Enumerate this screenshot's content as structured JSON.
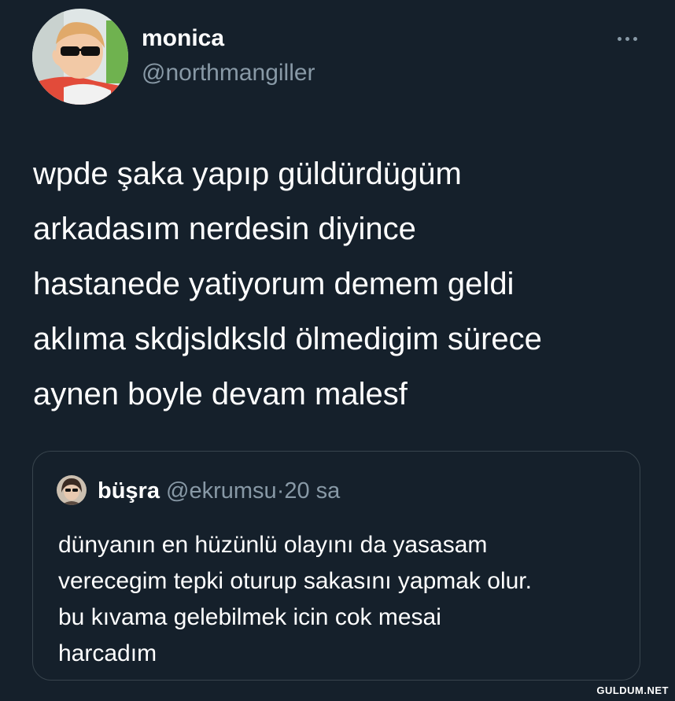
{
  "tweet": {
    "author": {
      "display_name": "monica",
      "handle": "@northmangiller",
      "avatar_icon": "profile-photo-child-sunglasses-icon"
    },
    "more_icon": "more-options-icon",
    "text": "wpde şaka yapıp güldürdügüm\narkadasım nerdesin diyince\nhastanede yatiyorum demem geldi\naklıma skdjsldksld ölmedigim sürece\naynen boyle devam malesf"
  },
  "quoted_tweet": {
    "display_name": "büşra",
    "handle": "@ekrumsu",
    "separator": "·",
    "time": "20 sa",
    "avatar_icon": "profile-photo-sunglasses-icon",
    "text": "dünyanın en hüzünlü olayını da yasasam\nverecegim tepki oturup sakasını yapmak olur.\nbu kıvama gelebilmek icin cok mesai\nharcadım"
  },
  "watermark": "GULDUM.NET",
  "colors": {
    "background": "#15202b",
    "secondary_text": "#8899a6",
    "border": "#38444d"
  }
}
